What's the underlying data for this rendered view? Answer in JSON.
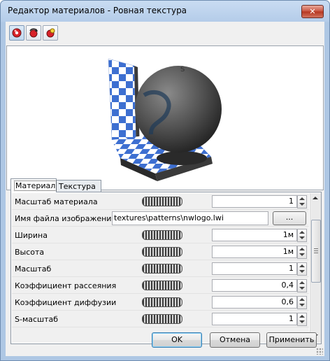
{
  "window": {
    "title": "Редактор материалов - Ровная текстура",
    "close_label": "✕"
  },
  "toolbar": {
    "buttons": [
      {
        "name": "render-sphere-icon"
      },
      {
        "name": "rotate-icon"
      },
      {
        "name": "light-icon"
      }
    ]
  },
  "tabs": [
    {
      "label": "Материал",
      "selected": true
    },
    {
      "label": "Текстура",
      "selected": false
    }
  ],
  "properties": [
    {
      "label": "Масштаб материала",
      "value": "1",
      "type": "number"
    },
    {
      "label": "Имя файла изображения",
      "value": "textures\\patterns\\nwlogo.lwi",
      "type": "file",
      "browse_label": "..."
    },
    {
      "label": "Ширина",
      "value": "1м",
      "type": "number"
    },
    {
      "label": "Высота",
      "value": "1м",
      "type": "number"
    },
    {
      "label": "Масштаб",
      "value": "1",
      "type": "number"
    },
    {
      "label": "Коэффициент рассеяния",
      "value": "0,4",
      "type": "number"
    },
    {
      "label": "Коэффициент диффузии",
      "value": "0,6",
      "type": "number"
    },
    {
      "label": "S-масштаб",
      "value": "1",
      "type": "number"
    }
  ],
  "buttons": {
    "ok": "OK",
    "cancel": "Отмена",
    "apply": "Применить"
  },
  "colors": {
    "checker_blue": "#3d6fd1",
    "sphere": "#5a5a5a",
    "close_red": "#c7503c"
  }
}
